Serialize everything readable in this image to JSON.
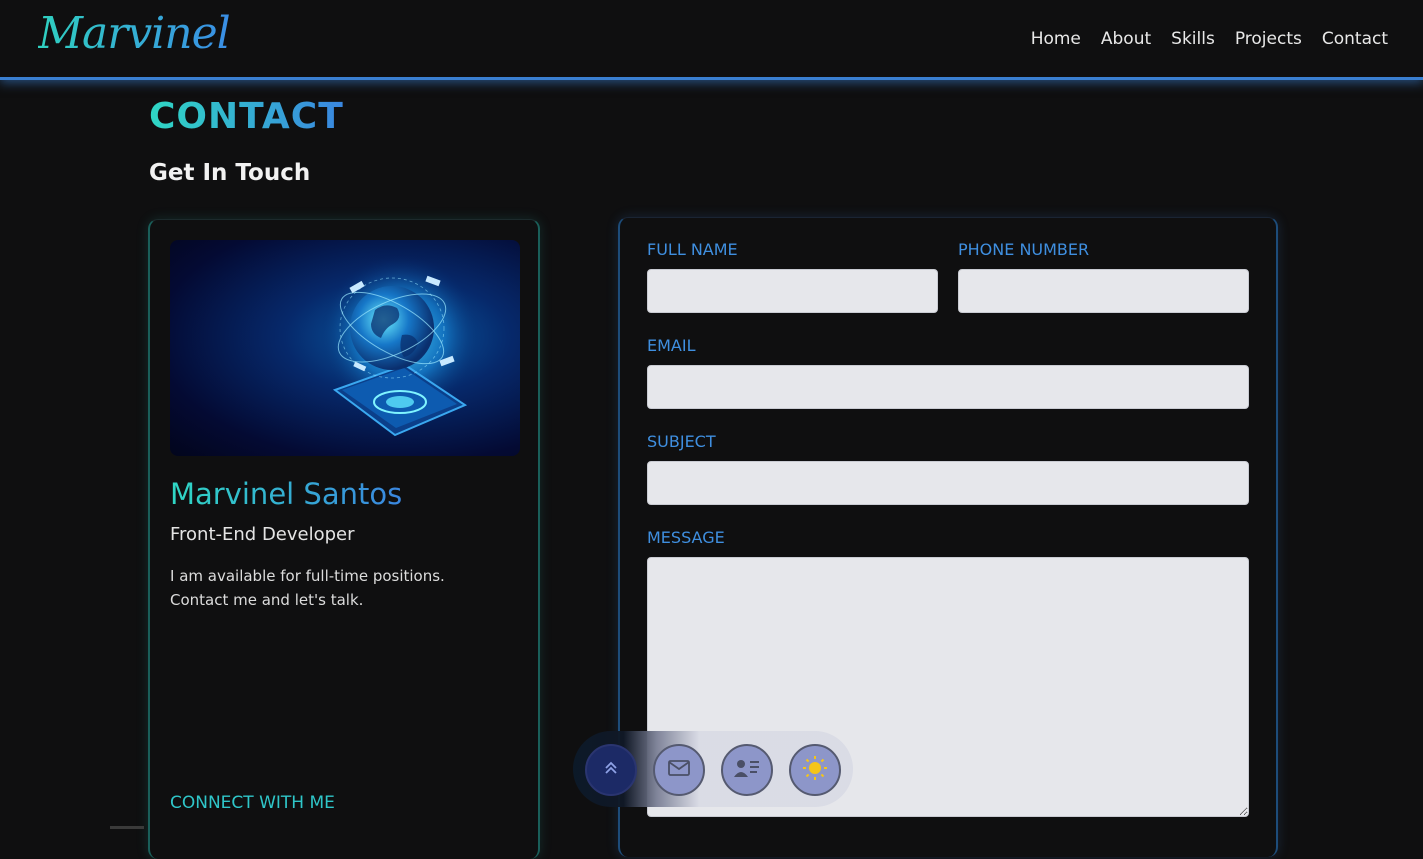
{
  "nav": {
    "logo": "Marvinel",
    "links": [
      "Home",
      "About",
      "Skills",
      "Projects",
      "Contact"
    ]
  },
  "section": {
    "title": "CONTACT",
    "subtitle": "Get In Touch"
  },
  "info_card": {
    "name": "Marvinel Santos",
    "role": "Front-End Developer",
    "description_line1": "I am available for full-time positions.",
    "description_line2": "Contact me and let's talk.",
    "connect_label": "CONNECT WITH ME"
  },
  "form": {
    "full_name_label": "FULL NAME",
    "phone_label": "PHONE NUMBER",
    "email_label": "EMAIL",
    "subject_label": "SUBJECT",
    "message_label": "MESSAGE",
    "full_name_value": "",
    "phone_value": "",
    "email_value": "",
    "subject_value": "",
    "message_value": ""
  },
  "floating_menu": {
    "icons": [
      "double-chevron-up-icon",
      "mail-icon",
      "contact-card-icon",
      "sun-icon"
    ]
  },
  "colors": {
    "accent_teal": "#2fd7c4",
    "accent_blue": "#3a86e0",
    "background": "#0f0f10",
    "input_bg": "#e6e7eb"
  }
}
